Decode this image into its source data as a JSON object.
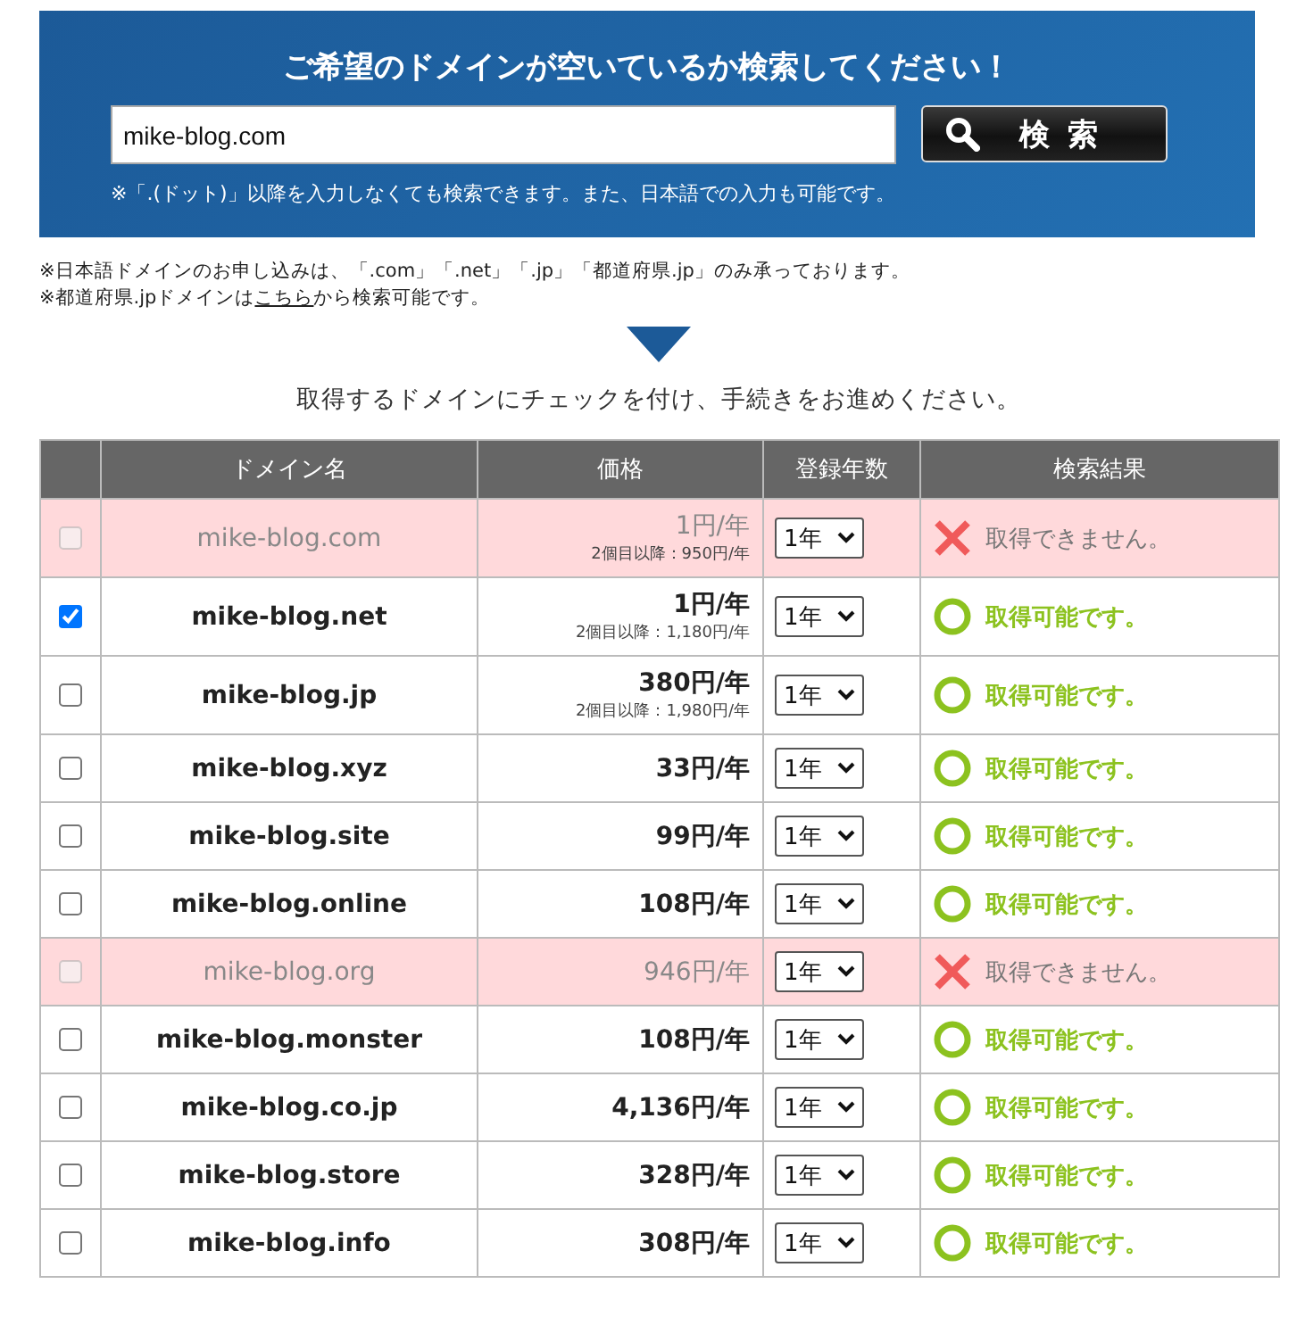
{
  "search_panel": {
    "title": "ご希望のドメインが空いているか検索してください！",
    "query": "mike-blog.com",
    "button": "検 索",
    "hint": "※「.(ドット)」以降を入力しなくても検索できます。また、日本語での入力も可能です。"
  },
  "notes": [
    {
      "text": "※日本語ドメインのお申し込みは、「.com」「.net」「.jp」「都道府県.jp」のみ承っております。"
    },
    {
      "before": "※都道府県.jpドメインは",
      "link": "こちら",
      "after": "から検索可能です。"
    }
  ],
  "instruction": "取得するドメインにチェックを付け、手続きをお進めください。",
  "table": {
    "columns": [
      "ドメイン名",
      "価格",
      "登録年数",
      "検索結果"
    ],
    "rows": [
      {
        "domain": "mike-blog.com",
        "price": "1円/年",
        "price_note": "2個目以降：950円/年",
        "years": "1年",
        "result": "取得できません。",
        "available": false,
        "checked": false
      },
      {
        "domain": "mike-blog.net",
        "price": "1円/年",
        "price_note": "2個目以降：1,180円/年",
        "years": "1年",
        "result": "取得可能です。",
        "available": true,
        "checked": true
      },
      {
        "domain": "mike-blog.jp",
        "price": "380円/年",
        "price_note": "2個目以降：1,980円/年",
        "years": "1年",
        "result": "取得可能です。",
        "available": true,
        "checked": false
      },
      {
        "domain": "mike-blog.xyz",
        "price": "33円/年",
        "years": "1年",
        "result": "取得可能です。",
        "available": true,
        "checked": false
      },
      {
        "domain": "mike-blog.site",
        "price": "99円/年",
        "years": "1年",
        "result": "取得可能です。",
        "available": true,
        "checked": false
      },
      {
        "domain": "mike-blog.online",
        "price": "108円/年",
        "years": "1年",
        "result": "取得可能です。",
        "available": true,
        "checked": false
      },
      {
        "domain": "mike-blog.org",
        "price": "946円/年",
        "years": "1年",
        "result": "取得できません。",
        "available": false,
        "checked": false
      },
      {
        "domain": "mike-blog.monster",
        "price": "108円/年",
        "years": "1年",
        "result": "取得可能です。",
        "available": true,
        "checked": false
      },
      {
        "domain": "mike-blog.co.jp",
        "price": "4,136円/年",
        "years": "1年",
        "result": "取得可能です。",
        "available": true,
        "checked": false
      },
      {
        "domain": "mike-blog.store",
        "price": "328円/年",
        "years": "1年",
        "result": "取得可能です。",
        "available": true,
        "checked": false
      },
      {
        "domain": "mike-blog.info",
        "price": "308円/年",
        "years": "1年",
        "result": "取得可能です。",
        "available": true,
        "checked": false
      }
    ]
  }
}
